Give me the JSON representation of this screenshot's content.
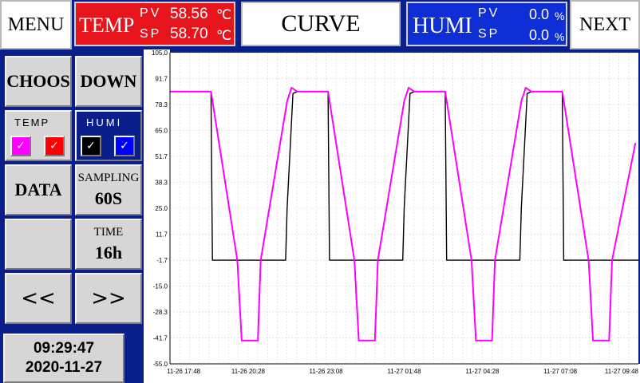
{
  "header": {
    "menu_label": "MENU",
    "next_label": "NEXT",
    "title": "CURVE",
    "temp": {
      "label": "TEMP",
      "pv_label": "PV",
      "sp_label": "SP",
      "pv_value": "58.56",
      "sp_value": "58.70",
      "unit": "℃",
      "bg_color": "#e8141c"
    },
    "humi": {
      "label": "HUMI",
      "pv_label": "PV",
      "sp_label": "SP",
      "pv_value": "0.0",
      "sp_value": "0.0",
      "unit": "%",
      "bg_color": "#0f2fd6"
    }
  },
  "sidebar": {
    "choos_label": "CHOOS",
    "down_label": "DOWN",
    "temp_label": "TEMP",
    "humi_label": "HUMI",
    "checkboxes": [
      {
        "name": "temp-pv",
        "color": "#ff00ff",
        "checked": true
      },
      {
        "name": "temp-sp",
        "color": "#ff0000",
        "checked": true
      },
      {
        "name": "humi-pv",
        "color": "#000000",
        "checked": true
      },
      {
        "name": "humi-sp",
        "color": "#0000ff",
        "checked": true
      }
    ],
    "data_label": "DATA",
    "sampling_label": "SAMPLING",
    "sampling_value": "60S",
    "time_label": "TIME",
    "time_value": "16h",
    "prev_label": "<<",
    "next_label": ">>"
  },
  "clock": {
    "time": "09:29:47",
    "date": "2020-11-27"
  },
  "chart_data": {
    "type": "line",
    "ylim": [
      -55.0,
      105.0
    ],
    "y_ticks": [
      "105.0",
      "91.7",
      "78.3",
      "65.0",
      "51.7",
      "38.3",
      "25.0",
      "11.7",
      "-1.7",
      "-15.0",
      "-28.3",
      "-41.7",
      "-55.0"
    ],
    "x_tick_labels": [
      "11-26 17:48",
      "11-26 20:28",
      "11-26 23:08",
      "11-27 01:48",
      "11-27 04:28",
      "11-27 07:08",
      "11-27 09:48"
    ],
    "xlim_hours": [
      0,
      16
    ],
    "grid": true,
    "series": [
      {
        "color": "#000000",
        "points": [
          [
            0,
            85
          ],
          [
            1.4,
            85
          ],
          [
            1.45,
            -1.7
          ],
          [
            3.95,
            -1.7
          ],
          [
            4.0,
            25
          ],
          [
            4.2,
            84
          ],
          [
            4.35,
            85
          ],
          [
            5.4,
            85
          ],
          [
            5.45,
            -1.7
          ],
          [
            7.95,
            -1.7
          ],
          [
            8.0,
            25
          ],
          [
            8.2,
            84
          ],
          [
            8.35,
            85
          ],
          [
            9.4,
            85
          ],
          [
            9.45,
            -1.7
          ],
          [
            11.95,
            -1.7
          ],
          [
            12.0,
            25
          ],
          [
            12.2,
            84
          ],
          [
            12.35,
            85
          ],
          [
            13.4,
            85
          ],
          [
            13.45,
            -1.7
          ],
          [
            16,
            -1.7
          ]
        ]
      },
      {
        "color": "#ff00ff",
        "points": [
          [
            0,
            85
          ],
          [
            1.4,
            85
          ],
          [
            2.3,
            -1.7
          ],
          [
            2.45,
            -43
          ],
          [
            3.0,
            -43
          ],
          [
            3.1,
            -1.7
          ],
          [
            4.0,
            80
          ],
          [
            4.15,
            87
          ],
          [
            4.35,
            85
          ],
          [
            5.4,
            85
          ],
          [
            6.3,
            -1.7
          ],
          [
            6.45,
            -43
          ],
          [
            7.0,
            -43
          ],
          [
            7.1,
            -1.7
          ],
          [
            8.0,
            80
          ],
          [
            8.15,
            87
          ],
          [
            8.35,
            85
          ],
          [
            9.4,
            85
          ],
          [
            10.3,
            -1.7
          ],
          [
            10.45,
            -43
          ],
          [
            11.0,
            -43
          ],
          [
            11.1,
            -1.7
          ],
          [
            12.0,
            80
          ],
          [
            12.15,
            87
          ],
          [
            12.35,
            85
          ],
          [
            13.4,
            85
          ],
          [
            14.3,
            -1.7
          ],
          [
            14.45,
            -43
          ],
          [
            15.0,
            -43
          ],
          [
            15.1,
            -1.7
          ],
          [
            15.9,
            58.56
          ]
        ]
      }
    ]
  }
}
